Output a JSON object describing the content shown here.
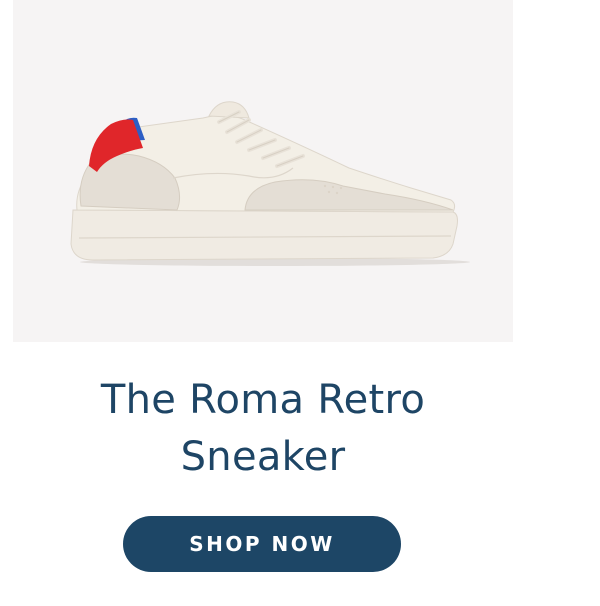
{
  "product": {
    "title": "The Roma Retro Sneaker",
    "image_alt": "The Roma Retro Sneaker",
    "cta_label": "SHOP NOW"
  },
  "colors": {
    "title": "#1e4565",
    "button_background": "#1d4666",
    "button_text": "#ffffff",
    "image_background": "#f6f4f4",
    "sneaker_leather": "#f3efe6",
    "sneaker_suede": "#e4ded5",
    "heel_tab": "#e0262a",
    "heel_accent": "#2d5ec4"
  },
  "icons": {
    "product_image": "sneaker-illustration"
  }
}
